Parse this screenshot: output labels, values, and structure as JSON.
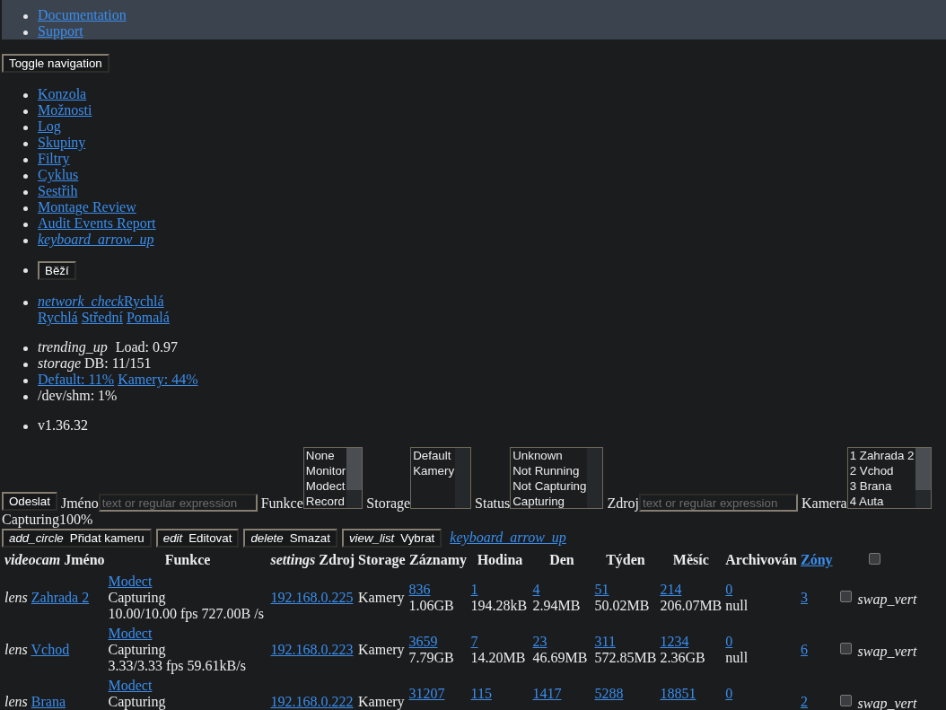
{
  "top_nav": {
    "items": [
      {
        "label": "Documentation"
      },
      {
        "label": "Support"
      }
    ]
  },
  "toggle_navigation": "Toggle navigation",
  "menu": {
    "items": [
      {
        "label": "Konzola"
      },
      {
        "label": "Možnosti"
      },
      {
        "label": "Log"
      },
      {
        "label": "Skupiny"
      },
      {
        "label": "Filtry"
      },
      {
        "label": "Cyklus"
      },
      {
        "label": "Sestřih"
      },
      {
        "label": "Montage Review"
      },
      {
        "label": "Audit Events Report"
      }
    ],
    "collapse_icon": "keyboard_arrow_up"
  },
  "run_state": "Běží",
  "bandwidth": {
    "icon": "network_check",
    "current": "Rychlá",
    "options": [
      {
        "label": "Rychlá"
      },
      {
        "label": "Střední"
      },
      {
        "label": "Pomalá"
      }
    ]
  },
  "system": {
    "load": {
      "icon": "trending_up",
      "text": "Load: 0.97"
    },
    "db": {
      "icon": "storage",
      "text": "DB: 11/151"
    },
    "storage_links": [
      {
        "label": "Default: 11%"
      },
      {
        "label": "Kamery: 44%"
      }
    ],
    "shm": "/dev/shm: 1%"
  },
  "version": "v1.36.32",
  "filters": {
    "submit": "Odeslat",
    "fields": [
      {
        "kind": "text",
        "label": "Jméno",
        "placeholder": "text or regular expression"
      },
      {
        "kind": "listbox",
        "label": "Funkce",
        "scrollable": true,
        "options": [
          {
            "label": "None",
            "selected": false
          },
          {
            "label": "Monitor",
            "selected": false
          },
          {
            "label": "Modect",
            "selected": false
          },
          {
            "label": "Record",
            "selected": false
          }
        ]
      },
      {
        "kind": "listbox",
        "label": "Storage",
        "scrollable": false,
        "options": [
          {
            "label": "Default",
            "selected": false
          },
          {
            "label": "Kamery",
            "selected": false
          }
        ]
      },
      {
        "kind": "listbox",
        "label": "Status",
        "scrollable": false,
        "options": [
          {
            "label": "Unknown",
            "selected": false
          },
          {
            "label": "Not Running",
            "selected": false
          },
          {
            "label": "Not Capturing",
            "selected": false
          },
          {
            "label": "Capturing",
            "selected": false
          }
        ]
      },
      {
        "kind": "text",
        "label": "Zdroj",
        "placeholder": "text or regular expression"
      },
      {
        "kind": "listbox",
        "label": "Kamera",
        "scrollable": true,
        "options": [
          {
            "label": "1 Zahrada 2",
            "selected": false
          },
          {
            "label": "2 Vchod",
            "selected": false
          },
          {
            "label": "3 Brana",
            "selected": false
          },
          {
            "label": "4 Auta",
            "selected": false
          }
        ]
      }
    ]
  },
  "summary": "Capturing100%",
  "actions": [
    {
      "icon": "add_circle",
      "label": "Přidat kameru"
    },
    {
      "icon": "edit",
      "label": "Editovat"
    },
    {
      "icon": "delete",
      "label": "Smazat"
    },
    {
      "icon": "view_list",
      "label": "Vybrat"
    }
  ],
  "actions_collapse_icon": "keyboard_arrow_up",
  "table": {
    "columns": [
      {
        "kind": "text",
        "icon": "videocam",
        "label": "Jméno"
      },
      {
        "kind": "text",
        "label": "Funkce"
      },
      {
        "kind": "text",
        "icon": "settings",
        "label": "Zdroj"
      },
      {
        "kind": "text",
        "label": "Storage"
      },
      {
        "kind": "text",
        "label": "Záznamy"
      },
      {
        "kind": "text",
        "label": "Hodina"
      },
      {
        "kind": "text",
        "label": "Den"
      },
      {
        "kind": "text",
        "label": "Týden"
      },
      {
        "kind": "text",
        "label": "Měsíc"
      },
      {
        "kind": "text",
        "label": "Archivován"
      },
      {
        "kind": "link",
        "label": "Zóny"
      },
      {
        "kind": "checkbox",
        "checked": false
      }
    ],
    "rows": [
      {
        "icon": "lens",
        "name": "Zahrada 2",
        "function": "Modect",
        "status": "Capturing",
        "rate": "10.00/10.00 fps 727.00B /s",
        "source": "192.168.0.225",
        "storage": "Kamery",
        "events": [
          {
            "count": "836",
            "size": "1.06GB"
          },
          {
            "count": "1",
            "size": "194.28kB"
          },
          {
            "count": "4",
            "size": "2.94MB"
          },
          {
            "count": "51",
            "size": "50.02MB"
          },
          {
            "count": "214",
            "size": "206.07MB"
          },
          {
            "count": "0",
            "size": "null"
          }
        ],
        "zones": "3",
        "checked": false,
        "sort_icon": "swap_vert"
      },
      {
        "icon": "lens",
        "name": "Vchod",
        "function": "Modect",
        "status": "Capturing",
        "rate": "3.33/3.33 fps 59.61kB/s",
        "source": "192.168.0.223",
        "storage": "Kamery",
        "events": [
          {
            "count": "3659",
            "size": "7.79GB"
          },
          {
            "count": "7",
            "size": "14.20MB"
          },
          {
            "count": "23",
            "size": "46.69MB"
          },
          {
            "count": "311",
            "size": "572.85MB"
          },
          {
            "count": "1234",
            "size": "2.36GB"
          },
          {
            "count": "0",
            "size": "null"
          }
        ],
        "zones": "6",
        "checked": false,
        "sort_icon": "swap_vert"
      },
      {
        "icon": "lens",
        "name": "Brana",
        "function": "Modect",
        "status": "Capturing",
        "source": "192.168.0.222",
        "storage": "Kamery",
        "events": [
          {
            "count": "31207"
          },
          {
            "count": "115"
          },
          {
            "count": "1417"
          },
          {
            "count": "5288"
          },
          {
            "count": "18851"
          },
          {
            "count": "0"
          }
        ],
        "zones": "2",
        "checked": false,
        "sort_icon": "swap_vert"
      }
    ]
  }
}
